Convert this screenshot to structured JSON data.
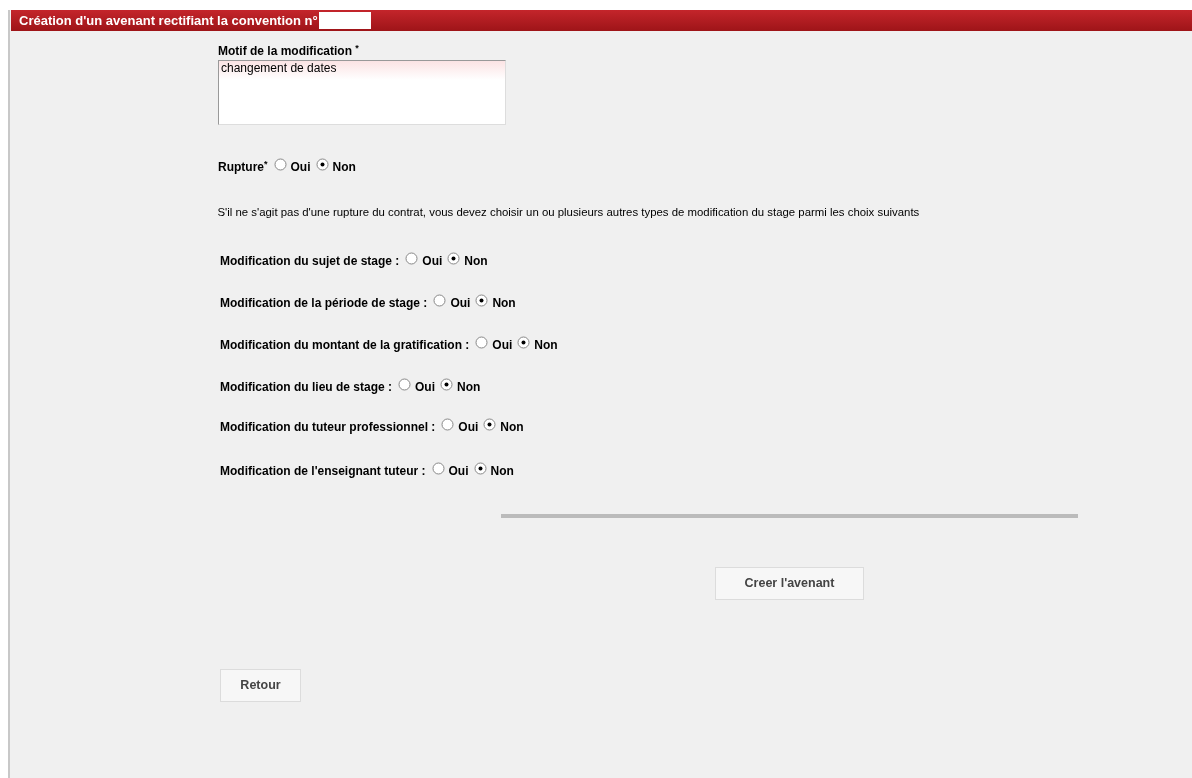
{
  "header": {
    "title": "Création d'un avenant rectifiant la convention n°",
    "redacted": true
  },
  "motif": {
    "label": "Motif de la modification $^{*}$",
    "value": "changement de dates"
  },
  "rupture": {
    "label": "Rupture$^{*}$",
    "options": [
      {
        "label": "Oui",
        "selected": false
      },
      {
        "label": "Non",
        "selected": true
      }
    ]
  },
  "instruction": "S'il ne s'agit pas d'une rupture du contrat, vous devez choisir un ou plusieurs autres types de modification du stage parmi les choix suivants",
  "modifications": [
    {
      "label": "Modification du sujet de stage :",
      "options": [
        {
          "label": "Oui",
          "selected": false
        },
        {
          "label": "Non",
          "selected": true
        }
      ]
    },
    {
      "label": "Modification de la période de stage :",
      "options": [
        {
          "label": "Oui",
          "selected": false
        },
        {
          "label": "Non",
          "selected": true
        }
      ]
    },
    {
      "label": "Modification du montant de la gratification :",
      "options": [
        {
          "label": "Oui",
          "selected": false
        },
        {
          "label": "Non",
          "selected": true
        }
      ]
    },
    {
      "label": "Modification du lieu de stage :",
      "options": [
        {
          "label": "Oui",
          "selected": false
        },
        {
          "label": "Non",
          "selected": true
        }
      ]
    },
    {
      "label": "Modification du tuteur professionnel :",
      "options": [
        {
          "label": "Oui",
          "selected": false
        },
        {
          "label": "Non",
          "selected": true
        }
      ]
    },
    {
      "label": "Modification de l'enseignant tuteur :",
      "options": [
        {
          "label": "Oui",
          "selected": false
        },
        {
          "label": "Non",
          "selected": true
        }
      ]
    }
  ],
  "buttons": {
    "create": "Creer l'avenant",
    "back": "Retour"
  }
}
